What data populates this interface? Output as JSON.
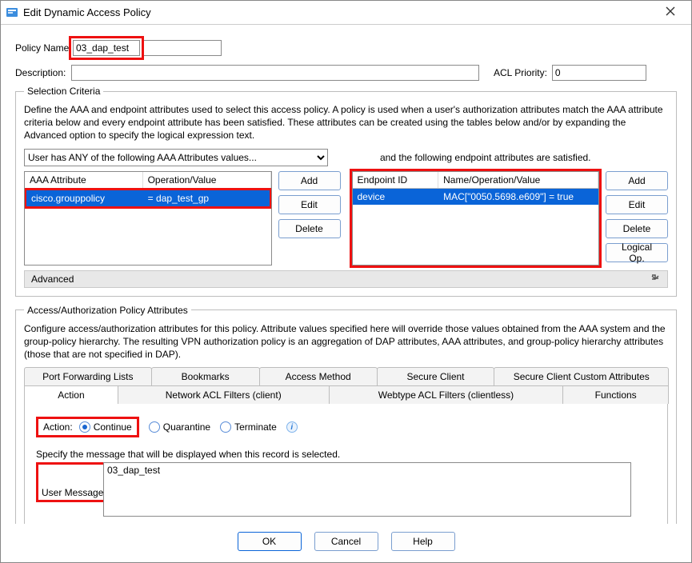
{
  "window": {
    "title": "Edit Dynamic Access Policy"
  },
  "fields": {
    "policy_name_label": "Policy Name",
    "policy_name_value": "03_dap_test",
    "description_label": "Description:",
    "description_value": "",
    "acl_priority_label": "ACL Priority:",
    "acl_priority_value": "0"
  },
  "selection": {
    "legend": "Selection Criteria",
    "desc": "Define the AAA and endpoint attributes used to select this access policy. A policy is used when a user's authorization attributes match the AAA attribute criteria below and every endpoint attribute has been satisfied. These attributes can be created using the tables below and/or by expanding the Advanced option to specify the logical expression text.",
    "combo_value": "User has ANY of the following AAA Attributes values...",
    "right_label": "and the following endpoint attributes are satisfied.",
    "aaa_headers": [
      "AAA Attribute",
      "Operation/Value"
    ],
    "aaa_row": {
      "attr": "cisco.grouppolicy",
      "op": "=   dap_test_gp"
    },
    "ep_headers": [
      "Endpoint ID",
      "Name/Operation/Value"
    ],
    "ep_row": {
      "id": "device",
      "val": "MAC[\"0050.5698.e609\"]  =  true"
    },
    "btns": {
      "add": "Add",
      "edit": "Edit",
      "delete": "Delete",
      "logical": "Logical Op."
    },
    "advanced": "Advanced"
  },
  "access": {
    "legend": "Access/Authorization Policy Attributes",
    "desc": "Configure access/authorization attributes for this policy. Attribute values specified here will override those values obtained from the AAA system and the group-policy hierarchy. The resulting VPN authorization policy is an aggregation of DAP attributes, AAA attributes, and group-policy hierarchy attributes (those that are not specified in DAP).",
    "tabs_row1": [
      "Port Forwarding Lists",
      "Bookmarks",
      "Access Method",
      "Secure Client",
      "Secure Client Custom Attributes"
    ],
    "tabs_row2": [
      "Action",
      "Network ACL Filters (client)",
      "Webtype ACL Filters (clientless)",
      "Functions"
    ],
    "action_label": "Action:",
    "radios": {
      "continue": "Continue",
      "quarantine": "Quarantine",
      "terminate": "Terminate"
    },
    "msg_intro": "Specify the message that will be displayed when this record is selected.",
    "user_msg_label": "User Message:",
    "user_msg_value": "03_dap_test"
  },
  "footer": {
    "ok": "OK",
    "cancel": "Cancel",
    "help": "Help"
  }
}
